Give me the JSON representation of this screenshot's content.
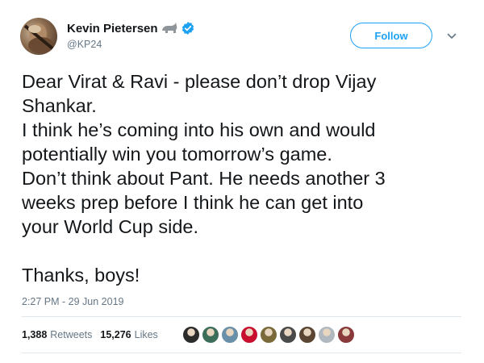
{
  "author": {
    "display_name": "Kevin Pietersen",
    "handle": "@KP24",
    "name_icon": "rhino-icon",
    "verified_icon": "verified-icon"
  },
  "follow_button": {
    "label": "Follow"
  },
  "menu": {
    "icon": "chevron-down-icon"
  },
  "tweet": {
    "lines": [
      "Dear Virat & Ravi - please don’t drop Vijay",
      "Shankar.",
      "I think he’s coming into his own and would",
      "potentially win you tomorrow’s game.",
      "Don’t think about Pant. He needs another 3",
      "weeks prep before I think he can get into",
      "your World Cup side."
    ],
    "closing": "Thanks, boys!",
    "timestamp": "2:27 PM - 29 Jun 2019"
  },
  "stats": {
    "retweets_count": "1,388",
    "retweets_label": "Retweets",
    "likes_count": "15,276",
    "likes_label": "Likes"
  },
  "likers": [
    {
      "name": "liker-avatar-1",
      "color": "#2b2b2b"
    },
    {
      "name": "liker-avatar-2",
      "color": "#3c6e5a"
    },
    {
      "name": "liker-avatar-3",
      "color": "#6a8fa8"
    },
    {
      "name": "liker-avatar-4",
      "color": "#c8102e"
    },
    {
      "name": "liker-avatar-5",
      "color": "#7a6a3a"
    },
    {
      "name": "liker-avatar-6",
      "color": "#4a4a4a"
    },
    {
      "name": "liker-avatar-7",
      "color": "#5a4632"
    },
    {
      "name": "liker-avatar-8",
      "color": "#b0b8c0"
    },
    {
      "name": "liker-avatar-9",
      "color": "#8a3a3a"
    }
  ],
  "colors": {
    "accent": "#1da1f2",
    "secondary_text": "#657786",
    "primary_text": "#14171a",
    "divider": "#e1e8ed"
  }
}
